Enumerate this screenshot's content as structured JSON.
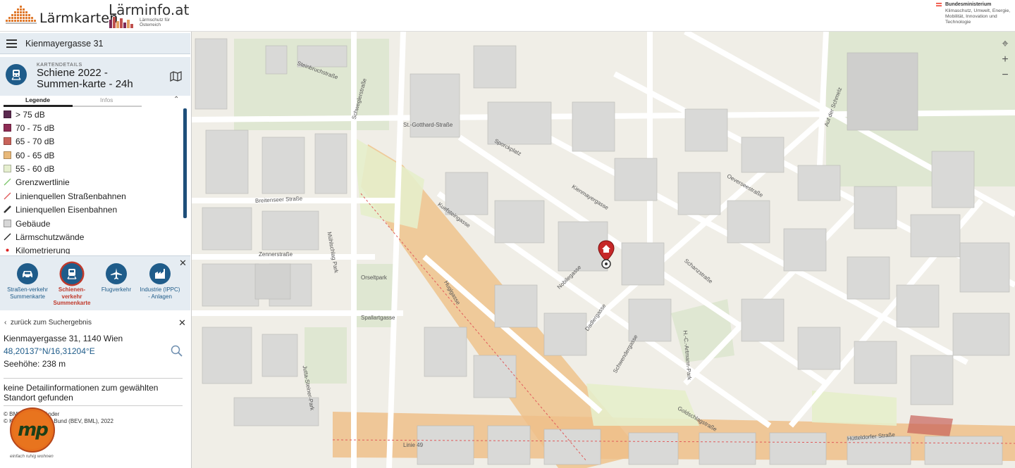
{
  "header": {
    "logo1_text": "Lärmkarten",
    "logo2_text": "Lärminfo.at",
    "logo2_sub": "Lärmschutz für Österreich",
    "ministry_title": "Bundesministerium",
    "ministry_sub": "Klimaschutz, Umwelt, Energie, Mobilität, Innovation und Technologie"
  },
  "search": {
    "value": "Kienmayergasse 31"
  },
  "card": {
    "kicker": "KARTENDETAILS",
    "title": "Schiene 2022 - Summen-karte - 24h"
  },
  "tabs": {
    "legend": "Legende",
    "infos": "Infos"
  },
  "legend": [
    {
      "label": "> 75 dB",
      "color": "#5b2a4f"
    },
    {
      "label": "70 - 75 dB",
      "color": "#8e2c55"
    },
    {
      "label": "65 - 70 dB",
      "color": "#c8635a"
    },
    {
      "label": "60 - 65 dB",
      "color": "#e8b97a"
    },
    {
      "label": "55 - 60 dB",
      "color": "#e6efcf"
    },
    {
      "label": "Grenzwertlinie",
      "kind": "line",
      "color": "#7cc56a"
    },
    {
      "label": "Linienquellen Straßenbahnen",
      "kind": "line",
      "color": "#e05a5a"
    },
    {
      "label": "Linienquellen Eisenbahnen",
      "kind": "rail",
      "color": "#333333"
    },
    {
      "label": "Gebäude",
      "kind": "box",
      "color": "#d7d7d7"
    },
    {
      "label": "Lärmschutzwände",
      "kind": "line",
      "color": "#222222"
    },
    {
      "label": "Kilometrierung",
      "kind": "dot",
      "color": "#d22"
    }
  ],
  "categories": [
    {
      "label": "Straßen-verkehr Summenkarte",
      "icon": "car-icon",
      "selected": false
    },
    {
      "label": "Schienen-verkehr Summenkarte",
      "icon": "train-icon",
      "selected": true
    },
    {
      "label": "Flugverkehr",
      "icon": "plane-icon",
      "selected": false
    },
    {
      "label": "Industrie (IPPC) - Anlagen",
      "icon": "factory-icon",
      "selected": false
    }
  ],
  "detail": {
    "back": "zurück zum Suchergebnis",
    "address": "Kienmayergasse 31, 1140 Wien",
    "coords": "48,20137°N/16,31204°E",
    "elevation": "Seehöhe: 238 m",
    "no_detail": "keine Detailinformationen zum gewählten Standort gefunden",
    "copyright1": "© BMK, Bundesländer",
    "copyright2": "© Kataster: Länder, Bund (BEV, BML), 2022",
    "slogan": "einfach ruhig wohnen",
    "logo_text": "mp"
  },
  "map": {
    "street_labels": [
      {
        "text": "Steinbruchstraße"
      },
      {
        "text": "St.-Gotthard-Straße"
      },
      {
        "text": "Sporckplatz"
      },
      {
        "text": "Breitenseer Straße"
      },
      {
        "text": "Kienmayergasse"
      },
      {
        "text": "Kuefsteingasse"
      },
      {
        "text": "Zennerstraße"
      },
      {
        "text": "Spallartgasse"
      },
      {
        "text": "Schanzstraße"
      },
      {
        "text": "Oeverseestraße"
      },
      {
        "text": "Auf der Schmelz"
      },
      {
        "text": "Linie 49"
      },
      {
        "text": "Hütteldorfer Straße"
      },
      {
        "text": "Schweglerstraße"
      },
      {
        "text": "Huglgasse"
      },
      {
        "text": "Nobilegasse"
      },
      {
        "text": "Dadlergasse"
      },
      {
        "text": "Schwendergasse"
      },
      {
        "text": "Goldschlagstraße"
      },
      {
        "text": "Mühlschlag Park"
      },
      {
        "text": "Orseltpark"
      },
      {
        "text": "Jutta-Steiner-Park"
      },
      {
        "text": "H.-C.-Artmann-Park"
      }
    ]
  }
}
